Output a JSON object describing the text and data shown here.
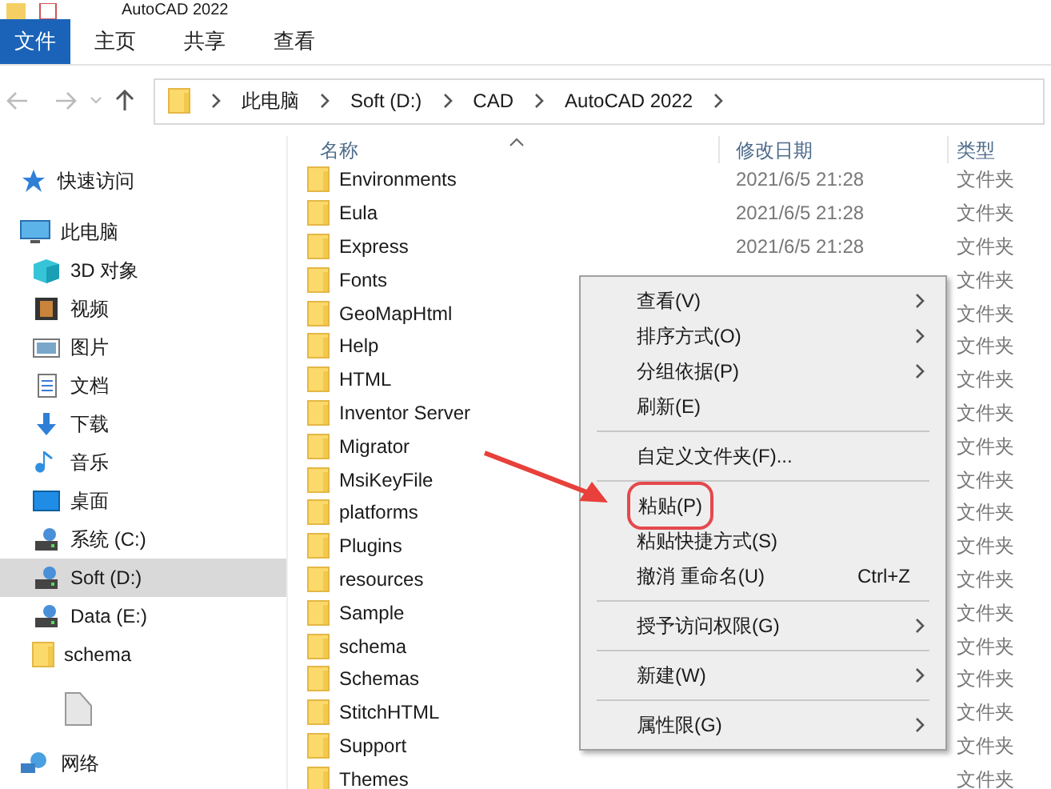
{
  "window": {
    "title": "AutoCAD 2022"
  },
  "ribbon_tabs": [
    {
      "label": "文件",
      "selected": true
    },
    {
      "label": "主页",
      "selected": false
    },
    {
      "label": "共享",
      "selected": false
    },
    {
      "label": "查看",
      "selected": false
    }
  ],
  "address_bar": {
    "crumbs": [
      "此电脑",
      "Soft (D:)",
      "CAD",
      "AutoCAD 2022"
    ]
  },
  "sidebar": {
    "items": [
      {
        "label": "快速访问",
        "kind": "star",
        "selected": false
      },
      {
        "label": "此电脑",
        "kind": "pc",
        "selected": false
      },
      {
        "label": "3D 对象",
        "kind": "cube",
        "selected": false
      },
      {
        "label": "视频",
        "kind": "video",
        "selected": false
      },
      {
        "label": "图片",
        "kind": "picture",
        "selected": false
      },
      {
        "label": "文档",
        "kind": "document",
        "selected": false
      },
      {
        "label": "下载",
        "kind": "download",
        "selected": false
      },
      {
        "label": "音乐",
        "kind": "music",
        "selected": false
      },
      {
        "label": "桌面",
        "kind": "desktop",
        "selected": false
      },
      {
        "label": "系统 (C:)",
        "kind": "drive",
        "selected": false
      },
      {
        "label": "Soft (D:)",
        "kind": "drive",
        "selected": true
      },
      {
        "label": "Data (E:)",
        "kind": "drive",
        "selected": false
      },
      {
        "label": "schema",
        "kind": "folder",
        "selected": false
      },
      {
        "label": "网络",
        "kind": "network",
        "selected": false
      }
    ]
  },
  "table": {
    "columns": [
      "名称",
      "修改日期",
      "类型"
    ],
    "rows": [
      {
        "name": "Environments",
        "date": "2021/6/5 21:28",
        "type": "文件夹"
      },
      {
        "name": "Eula",
        "date": "2021/6/5 21:28",
        "type": "文件夹"
      },
      {
        "name": "Express",
        "date": "2021/6/5 21:28",
        "type": "文件夹"
      },
      {
        "name": "Fonts",
        "type": "文件夹"
      },
      {
        "name": "GeoMapHtml",
        "type": "文件夹"
      },
      {
        "name": "Help",
        "type": "文件夹"
      },
      {
        "name": "HTML",
        "type": "文件夹"
      },
      {
        "name": "Inventor Server",
        "type": "文件夹"
      },
      {
        "name": "Migrator",
        "type": "文件夹"
      },
      {
        "name": "MsiKeyFile",
        "type": "文件夹"
      },
      {
        "name": "platforms",
        "type": "文件夹"
      },
      {
        "name": "Plugins",
        "type": "文件夹"
      },
      {
        "name": "resources",
        "type": "文件夹"
      },
      {
        "name": "Sample",
        "type": "文件夹"
      },
      {
        "name": "schema",
        "type": "文件夹"
      },
      {
        "name": "Schemas",
        "type": "文件夹"
      },
      {
        "name": "StitchHTML",
        "type": "文件夹"
      },
      {
        "name": "Support",
        "type": "文件夹"
      },
      {
        "name": "Themes",
        "type": "文件夹"
      }
    ]
  },
  "context_menu": {
    "items": [
      {
        "kind": "item",
        "label": "查看(V)",
        "submenu": true,
        "highlighted": false
      },
      {
        "kind": "item",
        "label": "排序方式(O)",
        "submenu": true,
        "highlighted": false
      },
      {
        "kind": "item",
        "label": "分组依据(P)",
        "submenu": true,
        "highlighted": false
      },
      {
        "kind": "item",
        "label": "刷新(E)",
        "submenu": false,
        "highlighted": false
      },
      {
        "kind": "separator"
      },
      {
        "kind": "item",
        "label": "自定义文件夹(F)...",
        "submenu": false,
        "highlighted": false
      },
      {
        "kind": "separator"
      },
      {
        "kind": "item",
        "label": "粘贴(P)",
        "submenu": false,
        "highlighted": true
      },
      {
        "kind": "item",
        "label": "粘贴快捷方式(S)",
        "submenu": false,
        "highlighted": false
      },
      {
        "kind": "item",
        "label": "撤消 重命名(U)",
        "shortcut": "Ctrl+Z",
        "submenu": false,
        "highlighted": false
      },
      {
        "kind": "separator"
      },
      {
        "kind": "item",
        "label": "授予访问权限(G)",
        "submenu": true,
        "highlighted": false
      },
      {
        "kind": "separator"
      },
      {
        "kind": "item",
        "label": "新建(W)",
        "submenu": true,
        "highlighted": false
      },
      {
        "kind": "separator"
      },
      {
        "kind": "item",
        "label": "属性限(G)",
        "submenu": true,
        "highlighted": false
      }
    ]
  }
}
